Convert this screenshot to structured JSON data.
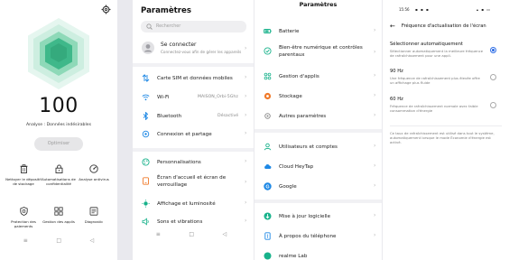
{
  "security_app": {
    "score": "100",
    "score_caption": "Analyse : Données indésirables",
    "optimize_button": "Optimiser",
    "tools": [
      {
        "label": "Nettoyer le dépositif de stockage",
        "icon": "trash-icon"
      },
      {
        "label": "Automatisations de confidentialité",
        "icon": "lock-icon"
      },
      {
        "label": "Analyse antivirus",
        "icon": "gauge-icon"
      },
      {
        "label": "Protection des paiements",
        "icon": "shield-icon"
      },
      {
        "label": "Gestion des applis",
        "icon": "grid-apps-icon"
      },
      {
        "label": "Diagnostic",
        "icon": "stethoscope-icon"
      }
    ],
    "accent_color": "#3fb88a"
  },
  "settings": {
    "title": "Paramètres",
    "search_placeholder": "Rechercher",
    "account": {
      "title": "Se connecter",
      "subtitle": "Connectez-vous afin de gérer les appareils"
    },
    "items": [
      {
        "label": "Carte SIM et données mobiles",
        "icon": "sim-icon",
        "value": ""
      },
      {
        "label": "Wi-Fi",
        "icon": "wifi-icon",
        "value": "MAISON_Orbi-5Ghz"
      },
      {
        "label": "Bluetooth",
        "icon": "bluetooth-icon",
        "value": "Désactivé"
      },
      {
        "label": "Connexion et partage",
        "icon": "share-icon",
        "value": ""
      },
      {
        "label": "Personnalisations",
        "icon": "palette-icon",
        "value": ""
      },
      {
        "label": "Écran d'accueil et écran de verrouillage",
        "icon": "home-screen-icon",
        "value": ""
      },
      {
        "label": "Affichage et luminosité",
        "icon": "brightness-icon",
        "value": ""
      },
      {
        "label": "Sons et vibrations",
        "icon": "sound-icon",
        "value": ""
      }
    ]
  },
  "settings_scrolled": {
    "title": "Paramètres",
    "items": [
      {
        "label": "Batterie",
        "icon": "battery-icon"
      },
      {
        "label": "Bien-être numérique et contrôles parentaux",
        "icon": "wellbeing-icon"
      },
      {
        "label": "Gestion d'applis",
        "icon": "apps-icon"
      },
      {
        "label": "Stockage",
        "icon": "storage-icon"
      },
      {
        "label": "Autres paramètres",
        "icon": "settings-icon"
      },
      {
        "label": "Utilisateurs et comptes",
        "icon": "users-icon"
      },
      {
        "label": "Cloud HeyTap",
        "icon": "cloud-icon"
      },
      {
        "label": "Google",
        "icon": "google-icon"
      },
      {
        "label": "Mise à jour logicielle",
        "icon": "update-icon"
      },
      {
        "label": "À propos du téléphone",
        "icon": "info-icon"
      },
      {
        "label": "realme Lab",
        "icon": "lab-icon"
      }
    ]
  },
  "refresh_rate": {
    "status_time": "15:56",
    "title": "Fréquence d'actualisation de l'écran",
    "options": [
      {
        "title": "Sélectionner automatiquement",
        "desc": "Sélectionner automatiquement la meilleure fréquence de rafraîchissement pour une appli.",
        "selected": true
      },
      {
        "title": "90 Hz",
        "desc": "Une fréquence de rafraîchissement plus élevée offre un affichage plus fluide",
        "selected": false
      },
      {
        "title": "60 Hz",
        "desc": "Fréquence de rafraîchissement normale avec faible consommation d'énergie",
        "selected": false
      }
    ],
    "note": "Ce taux de rafraîchissement est utilisé dans tout le système, automatiquement lorsque le mode Économie d'énergie est activé.",
    "accent_color": "#2f6ee6"
  }
}
